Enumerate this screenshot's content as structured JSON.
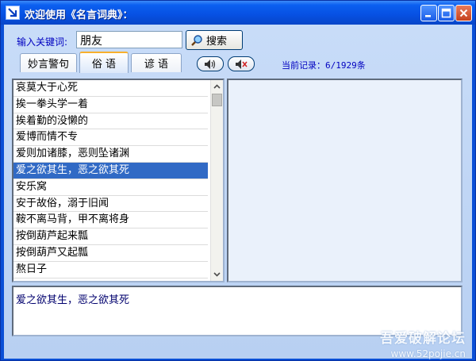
{
  "window": {
    "title": "欢迎使用《名言词典》："
  },
  "search": {
    "label": "输入关键词:",
    "value": "朋友",
    "button_label": "搜索"
  },
  "tabs": [
    {
      "label": "妙言警句",
      "active": false
    },
    {
      "label": "俗 语",
      "active": true
    },
    {
      "label": "谚 语",
      "active": false
    }
  ],
  "record": {
    "text": "当前记录：6/1929条"
  },
  "list": {
    "items": [
      "哀莫大于心死",
      "挨一拳头学一着",
      "挨着勤的没懒的",
      "爱博而情不专",
      "爱则加诸膝，恶则坠诸渊",
      "爱之欲其生，恶之欲其死",
      "安乐窝",
      "安于故俗，溺于旧闻",
      "鞍不离马背，甲不离将身",
      "按倒葫芦起来瓢",
      "按倒葫芦又起瓢",
      "熬日子"
    ],
    "selected_index": 5
  },
  "detail": {
    "text": ""
  },
  "bottom": {
    "text": "爱之欲其生，恶之欲其死"
  },
  "watermark": {
    "line1": "吾爱破解论坛",
    "line2": "www.52pojie.cn"
  },
  "icons": {
    "app": "arrow-down-right-icon",
    "search": "magnifier-icon",
    "speaker": "speaker-icon",
    "speaker_stop": "speaker-stop-icon"
  },
  "colors": {
    "titlebar": "#0750e2",
    "selection": "#316ac5",
    "label_text": "#0000c0"
  }
}
